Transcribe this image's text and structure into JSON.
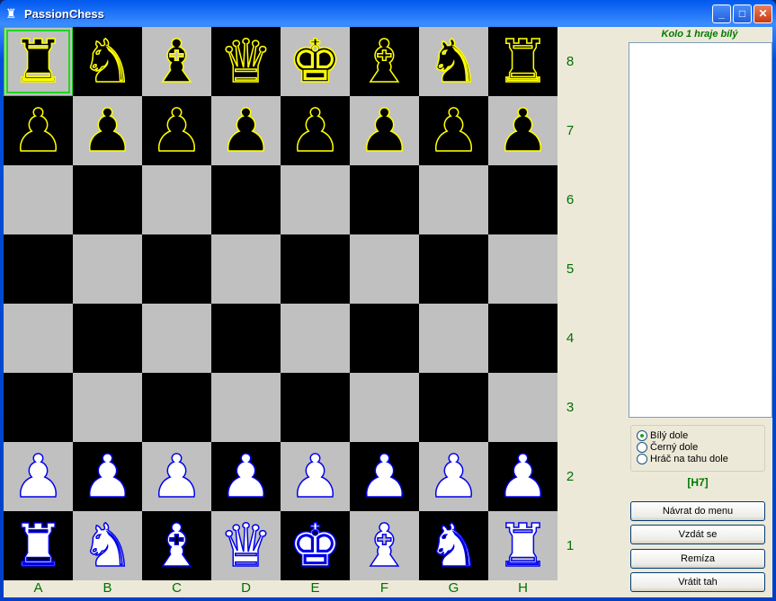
{
  "window": {
    "title": "PassionChess",
    "minimize": "_",
    "maximize": "□",
    "close": "✕"
  },
  "board": {
    "ranks": [
      "8",
      "7",
      "6",
      "5",
      "4",
      "3",
      "2",
      "1"
    ],
    "files": [
      "A",
      "B",
      "C",
      "D",
      "E",
      "F",
      "G",
      "H"
    ],
    "selected": "a8",
    "position": [
      [
        "br",
        "bn",
        "bb",
        "bq",
        "bk",
        "bb",
        "bn",
        "br"
      ],
      [
        "bp",
        "bp",
        "bp",
        "bp",
        "bp",
        "bp",
        "bp",
        "bp"
      ],
      [
        "",
        "",
        "",
        "",
        "",
        "",
        "",
        ""
      ],
      [
        "",
        "",
        "",
        "",
        "",
        "",
        "",
        ""
      ],
      [
        "",
        "",
        "",
        "",
        "",
        "",
        "",
        ""
      ],
      [
        "",
        "",
        "",
        "",
        "",
        "",
        "",
        ""
      ],
      [
        "wp",
        "wp",
        "wp",
        "wp",
        "wp",
        "wp",
        "wp",
        "wp"
      ],
      [
        "wr",
        "wn",
        "wb",
        "wq",
        "wk",
        "wb",
        "wn",
        "wr"
      ]
    ],
    "colors": {
      "light": "#c0c0c0",
      "dark": "#000000",
      "black_piece_outline": "#ffff00",
      "white_piece_outline": "#0000ee",
      "selection": "#1ed81e"
    }
  },
  "panel": {
    "status": "Kolo 1 hraje bílý",
    "orientation_options": [
      {
        "label": "Bílý dole",
        "checked": true
      },
      {
        "label": "Černý dole",
        "checked": false
      },
      {
        "label": "Hráč na tahu dole",
        "checked": false
      }
    ],
    "selected_square": "[H7]",
    "buttons": [
      "Návrat do menu",
      "Vzdát se",
      "Remíza",
      "Vrátit tah"
    ]
  }
}
